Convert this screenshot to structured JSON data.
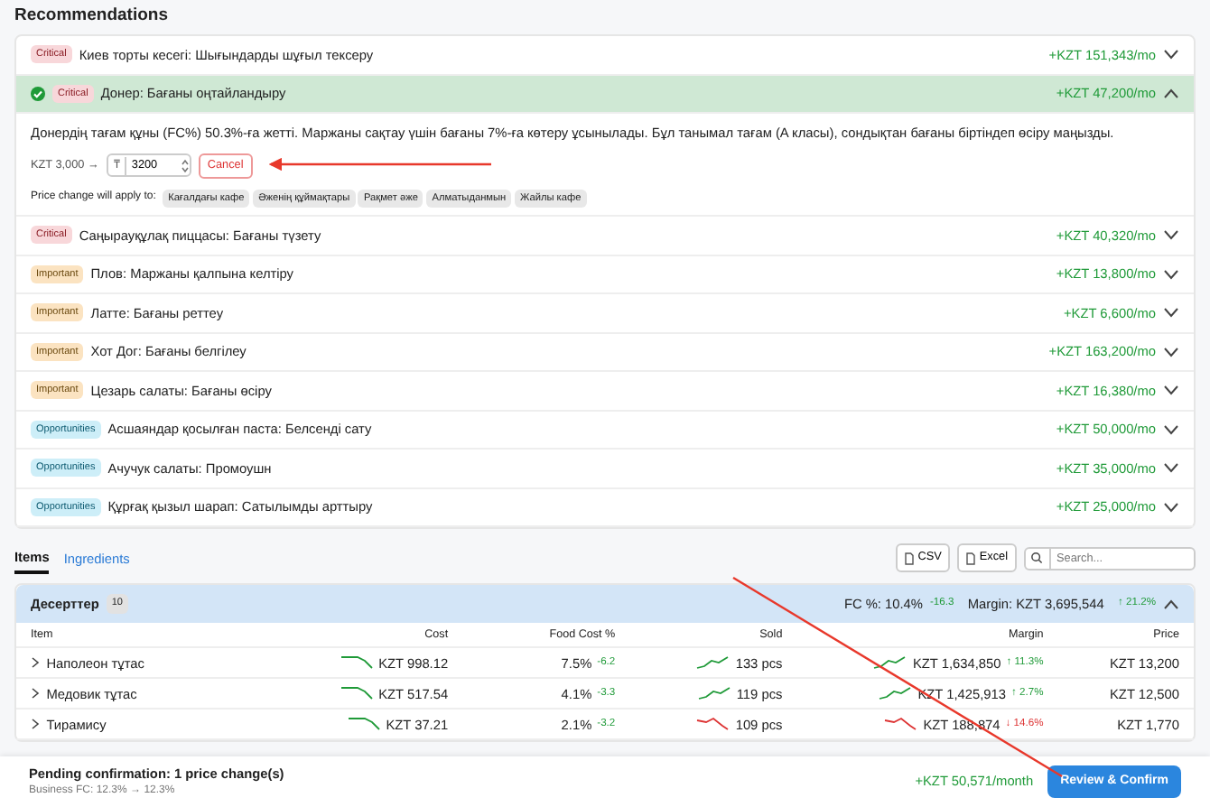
{
  "heading": "Recommendations",
  "recommendations": [
    {
      "kind": "critical",
      "badge": "Critical",
      "title": "Киев торты кесегі: Шығындарды шұғыл тексеру",
      "value": "+KZT 151,343/mo",
      "expanded": false,
      "applied": false
    },
    {
      "kind": "critical",
      "badge": "Critical",
      "title": "Донер: Бағаны оңтайландыру",
      "value": "+KZT 47,200/mo",
      "expanded": true,
      "applied": true,
      "detail": {
        "text": "Донердің тағам құны (FC%) 50.3%-ға жетті. Маржаны сақтау үшін бағаны 7%-ға көтеру ұсынылады. Бұл танымал тағам (A класы), сондықтан бағаны біртіндеп өсіру маңызды.",
        "from": "KZT 3,000 →",
        "currency": "₸",
        "price": "3200",
        "cancel": "Cancel",
        "apply_label": "Price change will apply to:",
        "locations": [
          "Кағалдағы кафе",
          "Әженің құймақтары",
          "Рақмет әже",
          "Алматыданмын",
          "Жайлы кафе"
        ]
      }
    },
    {
      "kind": "critical",
      "badge": "Critical",
      "title": "Саңырауқұлақ пиццасы: Бағаны түзету",
      "value": "+KZT 40,320/mo",
      "expanded": false,
      "applied": false
    },
    {
      "kind": "important",
      "badge": "Important",
      "title": "Плов: Маржаны қалпына келтіру",
      "value": "+KZT 13,800/mo",
      "expanded": false,
      "applied": false
    },
    {
      "kind": "important",
      "badge": "Important",
      "title": "Латте: Бағаны реттеу",
      "value": "+KZT 6,600/mo",
      "expanded": false,
      "applied": false
    },
    {
      "kind": "important",
      "badge": "Important",
      "title": "Хот Дог: Бағаны белгілеу",
      "value": "+KZT 163,200/mo",
      "expanded": false,
      "applied": false
    },
    {
      "kind": "important",
      "badge": "Important",
      "title": "Цезарь салаты: Бағаны өсіру",
      "value": "+KZT 16,380/mo",
      "expanded": false,
      "applied": false
    },
    {
      "kind": "opportunity",
      "badge": "Opportunities",
      "title": "Асшаяндар қосылған паста: Белсенді сату",
      "value": "+KZT 50,000/mo",
      "expanded": false,
      "applied": false
    },
    {
      "kind": "opportunity",
      "badge": "Opportunities",
      "title": "Ачучук салаты: Промоушн",
      "value": "+KZT 35,000/mo",
      "expanded": false,
      "applied": false
    },
    {
      "kind": "opportunity",
      "badge": "Opportunities",
      "title": "Құрғақ қызыл шарап: Сатылымды арттыру",
      "value": "+KZT 25,000/mo",
      "expanded": false,
      "applied": false
    }
  ],
  "tabs": [
    {
      "label": "Items",
      "selected": true
    },
    {
      "label": "Ingredients",
      "selected": false
    }
  ],
  "export_buttons": [
    "CSV",
    "Excel"
  ],
  "search": {
    "placeholder": "Search..."
  },
  "group": {
    "name": "Десерттер",
    "count": "10",
    "fc": "FC %: 10.4%",
    "fc_delta": "-16.3",
    "margin": "Margin: KZT 3,695,544",
    "margin_delta": "↑ 21.2%",
    "expanded": true
  },
  "columns": [
    "Item",
    "Cost",
    "Food Cost %",
    "Sold",
    "Margin",
    "Price"
  ],
  "rows": [
    {
      "name": "Наполеон тұтас",
      "cost": "KZT 998.12",
      "fc": "7.5%",
      "fc_delta": "-6.2",
      "sold": "133 pcs",
      "margin": "KZT 1,634,850",
      "margin_delta": "↑ 11.3%",
      "color": "#1f9a38",
      "price": "KZT 13,200"
    },
    {
      "name": "Медовик тұтас",
      "cost": "KZT 517.54",
      "fc": "4.1%",
      "fc_delta": "-3.3",
      "sold": "119 pcs",
      "margin": "KZT 1,425,913",
      "margin_delta": "↑ 2.7%",
      "color": "#1f9a38",
      "price": "KZT 12,500"
    },
    {
      "name": "Тирамису",
      "cost": "KZT 37.21",
      "fc": "2.1%",
      "fc_delta": "-3.2",
      "sold": "109 pcs",
      "margin": "KZT 188,874",
      "margin_delta": "↓ 14.6%",
      "color": "#dd3333",
      "price": "KZT 1,770"
    }
  ],
  "footer": {
    "pending": "Pending confirmation: 1 price change(s)",
    "business_fc": "Business FC: 12.3% → 12.3%",
    "total": "+KZT 50,571/month",
    "button": "Review & Confirm"
  }
}
